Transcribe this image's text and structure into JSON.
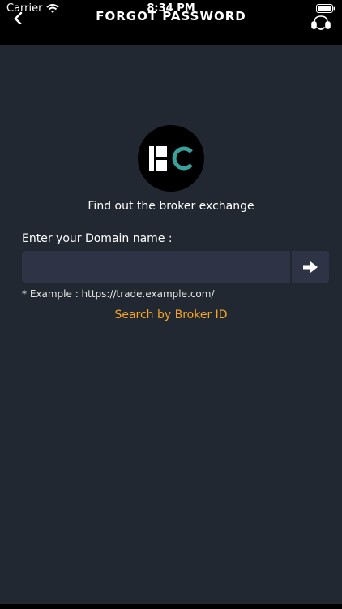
{
  "status_bar": {
    "carrier": "Carrier",
    "time": "8:34 PM"
  },
  "nav": {
    "title": "FORGOT PASSWORD",
    "back_icon": "chevron-left-icon",
    "support_icon": "customer-support-icon"
  },
  "main": {
    "logo_icon": "broker-logo-icon",
    "headline": "Find out the broker exchange",
    "domain_label": "Enter your Domain name :",
    "domain_value": "",
    "example": "* Example : https://trade.example.com/",
    "submit_icon": "arrow-right-icon",
    "broker_link": "Search by Broker ID"
  },
  "colors": {
    "background": "#222831",
    "header": "#000000",
    "input": "#2e3446",
    "accent": "#f5a623",
    "logo_teal": "#3aa09a"
  }
}
